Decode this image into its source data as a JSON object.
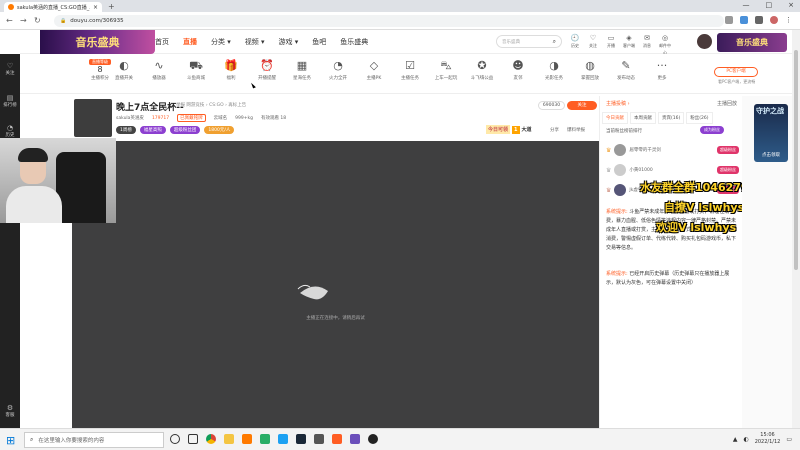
{
  "browser": {
    "tab_title": "sakula英涵的直播_CS:GO直播_斗",
    "url": "douyu.com/306935",
    "new_tab_label": "+"
  },
  "header": {
    "banner_text": "音乐盛典",
    "nav": [
      {
        "label": "首页"
      },
      {
        "label": "直播",
        "active": true
      },
      {
        "label": "分类 ▾"
      },
      {
        "label": "视频 ▾"
      },
      {
        "label": "游戏 ▾"
      },
      {
        "label": "鱼吧"
      },
      {
        "label": "鱼乐盛典"
      }
    ],
    "search_placeholder": "音乐盛典",
    "icons": [
      {
        "glyph": "🕘",
        "label": "历史"
      },
      {
        "glyph": "♡",
        "label": "关注"
      },
      {
        "glyph": "▭",
        "label": "开播"
      },
      {
        "glyph": "◈",
        "label": "客户端"
      },
      {
        "glyph": "✉",
        "label": "消息"
      },
      {
        "glyph": "◎",
        "label": "邮件中心"
      }
    ],
    "right_banner_text": "音乐盛典"
  },
  "toolbar": {
    "level_badge": "直播等级",
    "level_num": "8",
    "level_label": "主播积分",
    "items": [
      {
        "glyph": "◐",
        "label": "直播开关"
      },
      {
        "glyph": "∿",
        "label": "播放器"
      },
      {
        "glyph": "⛟",
        "label": "斗鱼商城"
      },
      {
        "glyph": "🎁",
        "label": "福利"
      },
      {
        "glyph": "⏰",
        "label": "开播提醒"
      },
      {
        "glyph": "▦",
        "label": "星海任务"
      },
      {
        "glyph": "◔",
        "label": "火力全开"
      },
      {
        "glyph": "◇",
        "label": "主播PK"
      },
      {
        "glyph": "☑",
        "label": "主播任务"
      },
      {
        "glyph": "⛍",
        "label": "上车一起玩"
      },
      {
        "glyph": "✪",
        "label": "斗飞嗨公益"
      },
      {
        "glyph": "☻",
        "label": "友邻"
      },
      {
        "glyph": "◑",
        "label": "光影任务"
      },
      {
        "glyph": "◍",
        "label": "掌握回放"
      },
      {
        "glyph": "✎",
        "label": "发布动态"
      },
      {
        "glyph": "···",
        "label": "更多"
      }
    ],
    "pc_button": "PC客户端",
    "pc_sub": "看PC客户端，更流畅"
  },
  "stream": {
    "title": "晚上7点全民杯--",
    "meta": "举报  网游竞技 › CS:GO › 再标上告",
    "streamer": "sakula英涵皮",
    "hot": "179717",
    "tag1": "已佩戴铭牌",
    "tag2": "云域名",
    "tag3": "999+kg",
    "tag4": "有效观看 18",
    "badges": [
      "1周榜",
      "福星高照",
      "超级粉丝团",
      "1800元/人"
    ],
    "room_id": "690030",
    "follow": "关注",
    "rank_label": "今日可领",
    "rank_num": "1",
    "rank_suffix": "大道",
    "share": "分享",
    "report": "爆料举报",
    "loading_message": "主播正在连接中，请稍后再试"
  },
  "right_panel": {
    "top_left": "主播投稿 ›",
    "top_right": "主播回放",
    "tabs": [
      "今日贡献",
      "本周贡献",
      "贵宾(16)",
      "粉丝(26)"
    ],
    "subtitle": "当前粉丝榜前排行",
    "sub_badge": "成为粉丝",
    "ranks": [
      {
        "name": "居零零的千灵剑",
        "badge": "超级粉丝"
      },
      {
        "name": "小黄01000",
        "badge": "超级粉丝"
      },
      {
        "name": "Jk虚夸",
        "badge": "超级粉丝"
      }
    ],
    "overlay_lines": [
      "水友群全群1046279188",
      "自撩V  lslwhys",
      "欢迎V  lslwhys"
    ],
    "sys1_label": "系统提示:",
    "sys1_text": "斗鱼严禁未成年人进行直播或打赏，请理性消费，暴力血腥、低俗色情等违规内容一律严格封禁。严禁未成年人直播或打赏，主播以不正当方式诱导打赏，注意理性消费，警惕虚假订单、代练代转、购买礼包码游戏币，私下交易等信息。",
    "sys2_label": "系统提示:",
    "sys2_text": "已经开启历史弹幕（历史弹幕只在播放器上展示，默认为灰色，可在弹幕设置中关闭）"
  },
  "ad": {
    "title": "守护之战",
    "cta": "点击领取"
  },
  "left_sidebar": [
    {
      "glyph": "♡",
      "label": "关注"
    },
    {
      "glyph": "▤",
      "label": "排行榜"
    },
    {
      "glyph": "◔",
      "label": "历史"
    },
    {
      "glyph": "⚙",
      "label": "客服"
    }
  ],
  "taskbar": {
    "search_placeholder": "在这里输入你要搜索的内容",
    "time": "15:06",
    "date": "2022/1/12"
  }
}
